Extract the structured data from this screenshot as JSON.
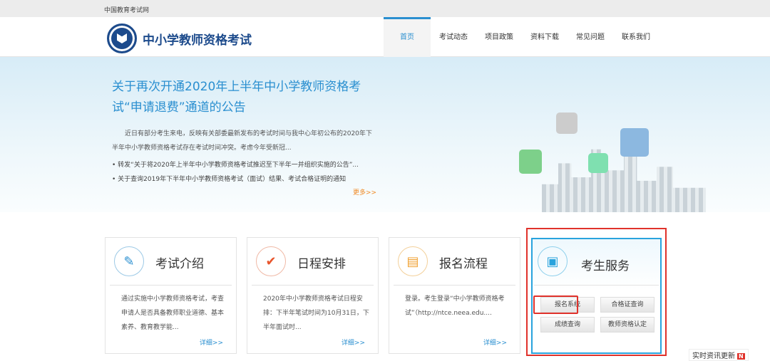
{
  "topbar": {
    "site": "中国教育考试网"
  },
  "header": {
    "title": "中小学教师资格考试"
  },
  "nav": [
    "首页",
    "考试动态",
    "项目政策",
    "资料下载",
    "常见问题",
    "联系我们"
  ],
  "banner": {
    "title": "关于再次开通2020年上半年中小学教师资格考试“申请退费”通道的公告",
    "summary": "近日有部分考生来电，反映有关部委最新发布的考试时间与我中心年初公布的2020年下半年中小学教师资格考试存在考试时间冲突。考虑今年受新冠...",
    "links": [
      "转发“关于将2020年上半年中小学教师资格考试推迟至下半年一并组织实施的公告”...",
      "关于查询2019年下半年中小学教师资格考试（面试）结果、考试合格证明的通知"
    ],
    "more": "更多>>"
  },
  "cards": [
    {
      "title": "考试介绍",
      "text": "通过实施中小学教师资格考试，考查申请人是否具备教师职业道德、基本素养、教育教学能...",
      "more": "详细>>"
    },
    {
      "title": "日程安排",
      "text": "2020年中小学教师资格考试日程安排：下半年笔试时间为10月31日，下半年面试时...",
      "more": "详细>>"
    },
    {
      "title": "报名流程",
      "text": "登录。考生登录“中小学教师资格考试”（http://ntce.neea.edu....",
      "more": "详细>>"
    }
  ],
  "service": {
    "title": "考生服务",
    "buttons": [
      "报名系统",
      "合格证查询",
      "成绩查询",
      "教师资格认定"
    ]
  },
  "live": {
    "label": "实时资讯更新",
    "badge": "N"
  }
}
